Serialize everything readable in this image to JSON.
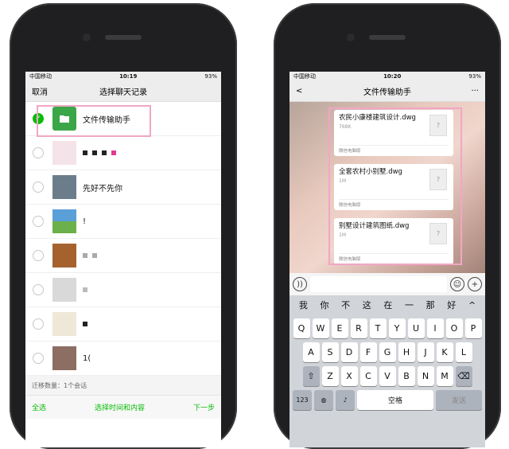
{
  "left": {
    "status": {
      "carrier": "中国移动",
      "time": "10:19",
      "battery": "93%"
    },
    "nav": {
      "cancel": "取消",
      "title": "选择聊天记录"
    },
    "rows": [
      {
        "name": "文件传输助手",
        "selected": true
      },
      {
        "name": "",
        "selected": false
      },
      {
        "name": "先好不先你",
        "selected": false
      },
      {
        "name": "!",
        "selected": false
      },
      {
        "name": "",
        "selected": false
      },
      {
        "name": "",
        "selected": false
      },
      {
        "name": "",
        "selected": false
      },
      {
        "name": "1(",
        "selected": false
      }
    ],
    "count_label": "迁移数量：",
    "count_value": "1个会话",
    "bottom": {
      "select_all": "全选",
      "time_content": "选择时间和内容",
      "next": "下一步"
    }
  },
  "right": {
    "status": {
      "carrier": "中国移动",
      "time": "10:20",
      "battery": "93%"
    },
    "nav": {
      "back": "<",
      "title": "文件传输助手",
      "more": "···"
    },
    "files": [
      {
        "name": "农民小康楼建筑设计.dwg",
        "size": "768K",
        "source": "微信电脑版"
      },
      {
        "name": "全套农村小别墅.dwg",
        "size": "1M",
        "source": "微信电脑版"
      },
      {
        "name": "别墅设计建筑图纸.dwg",
        "size": "1M",
        "source": "微信电脑版"
      }
    ],
    "file_icon": "?",
    "candidates": [
      "我",
      "你",
      "不",
      "这",
      "在",
      "一",
      "那",
      "好",
      "^"
    ],
    "keys_row1": [
      "Q",
      "W",
      "E",
      "R",
      "T",
      "Y",
      "U",
      "I",
      "O",
      "P"
    ],
    "keys_row2": [
      "A",
      "S",
      "D",
      "F",
      "G",
      "H",
      "J",
      "K",
      "L"
    ],
    "keys_row3": [
      "Z",
      "X",
      "C",
      "V",
      "B",
      "N",
      "M"
    ],
    "key_123": "123",
    "key_space": "空格",
    "key_send": "发送"
  }
}
